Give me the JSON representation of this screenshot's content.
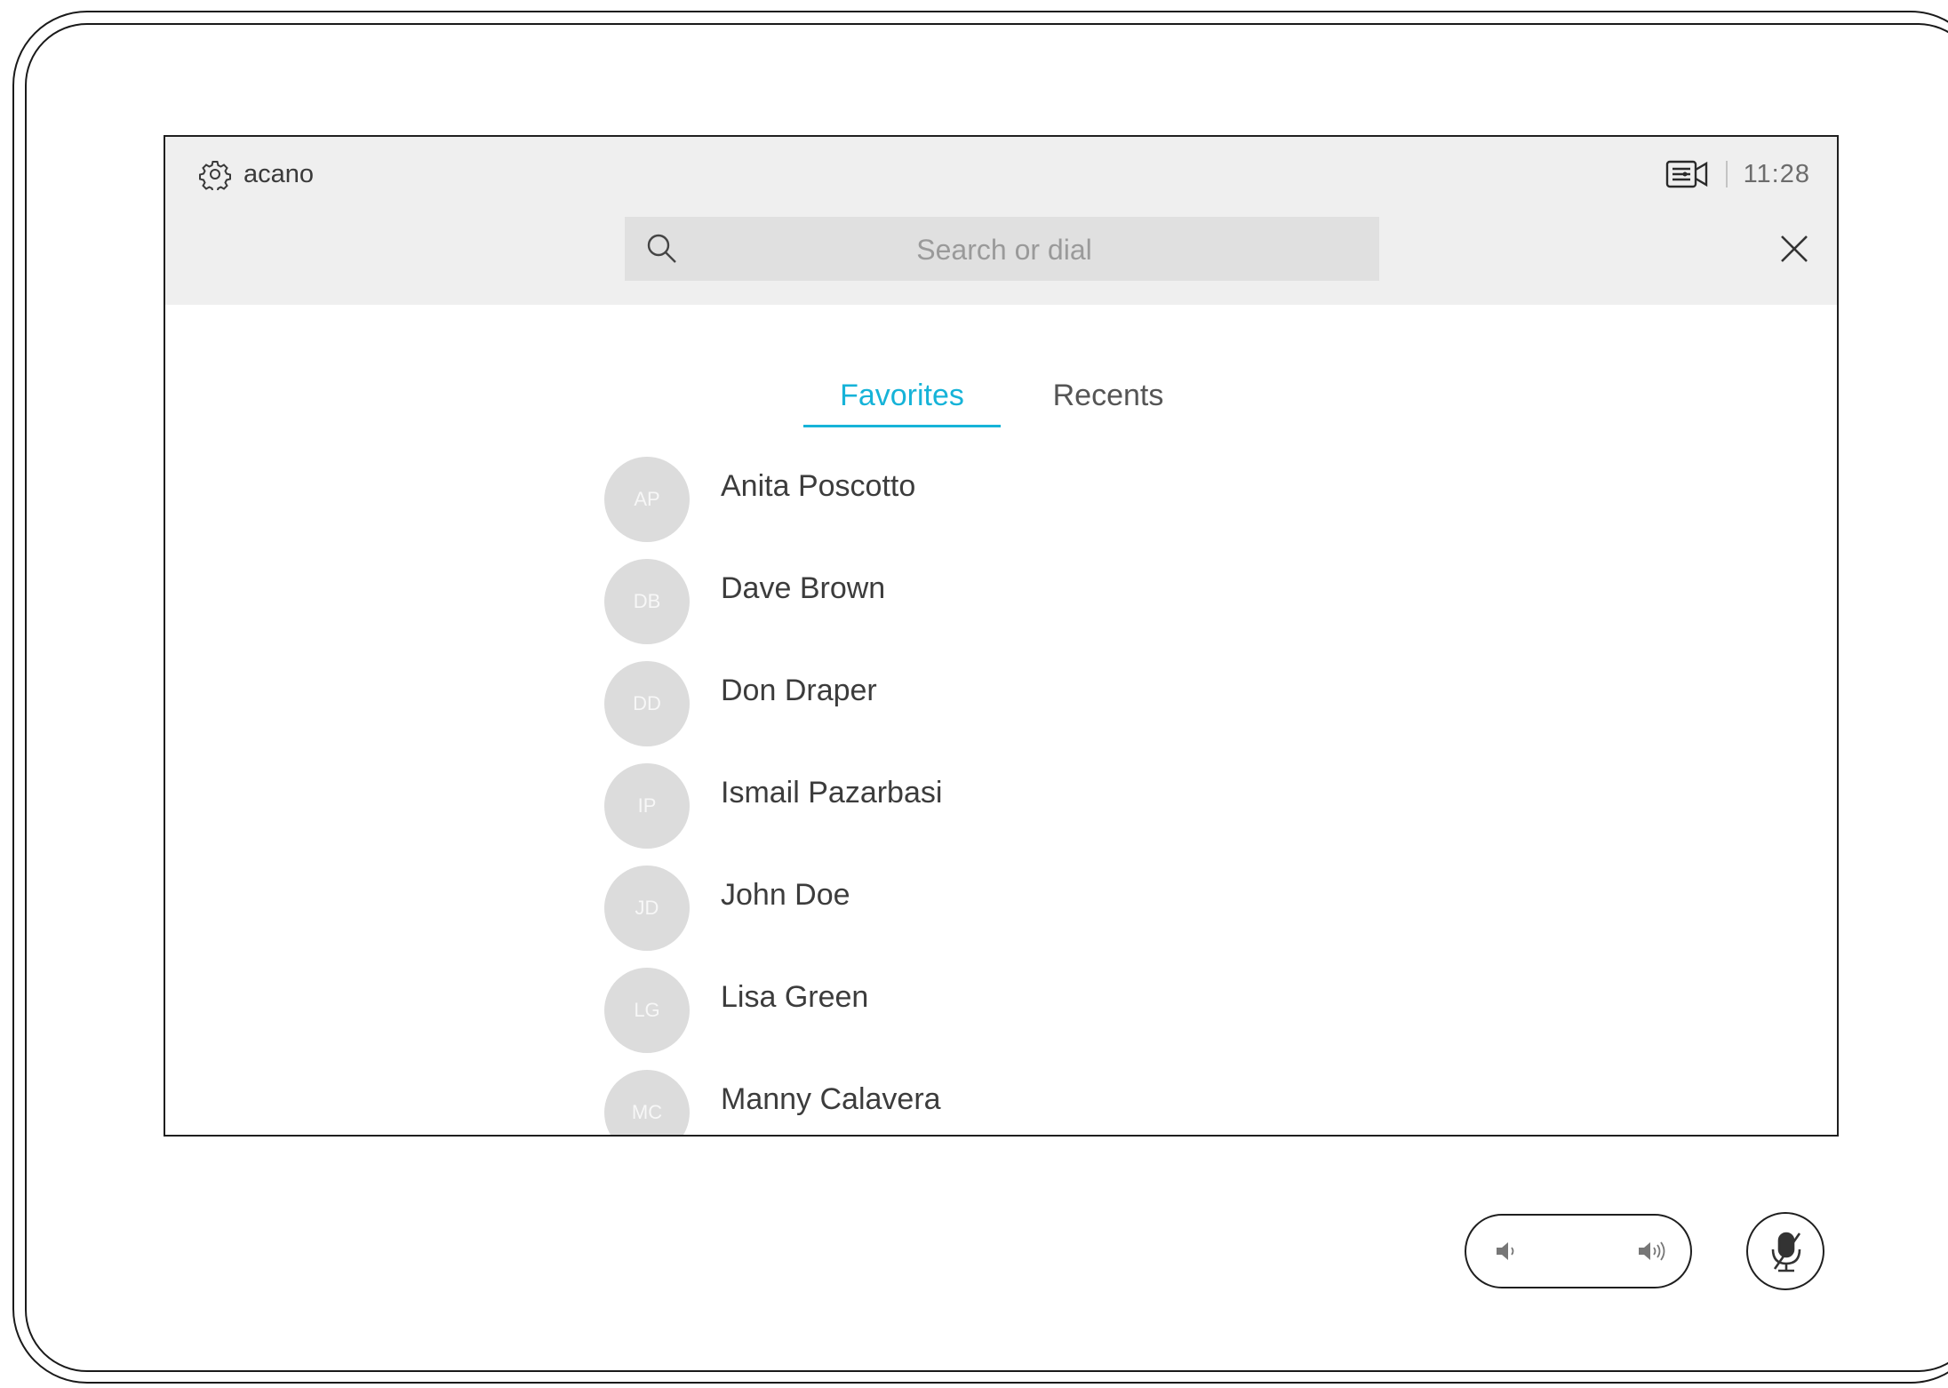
{
  "header": {
    "brand_label": "acano",
    "clock": "11:28",
    "settings_icon": "gear-icon",
    "camera_icon": "video-controls-icon"
  },
  "search": {
    "placeholder": "Search or dial",
    "value": ""
  },
  "tabs": [
    {
      "label": "Favorites",
      "active": true
    },
    {
      "label": "Recents",
      "active": false
    }
  ],
  "contacts": [
    {
      "initials": "AP",
      "name": "Anita Poscotto"
    },
    {
      "initials": "DB",
      "name": "Dave Brown"
    },
    {
      "initials": "DD",
      "name": "Don Draper"
    },
    {
      "initials": "IP",
      "name": "Ismail Pazarbasi"
    },
    {
      "initials": "JD",
      "name": "John Doe"
    },
    {
      "initials": "LG",
      "name": "Lisa Green"
    },
    {
      "initials": "MC",
      "name": "Manny Calavera"
    }
  ],
  "colors": {
    "accent": "#16b3d8",
    "header_bg": "#efefef",
    "avatar_bg": "#dcdcdc"
  },
  "controls": {
    "volume_icons": [
      "volume-down-icon",
      "volume-up-icon"
    ],
    "mute_icon": "microphone-muted-icon"
  }
}
